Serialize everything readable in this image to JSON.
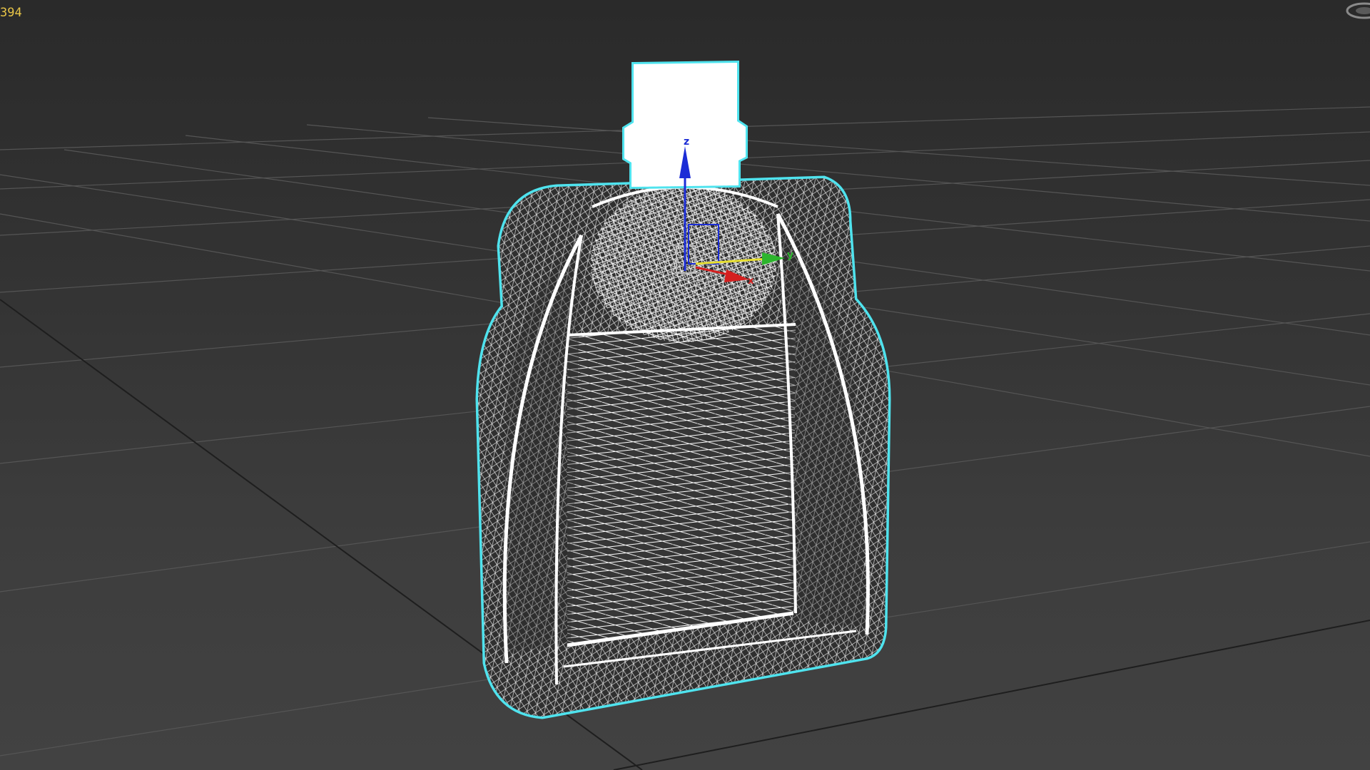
{
  "viewport": {
    "stats_value": "394",
    "shading_mode": "wireframe",
    "background_color": "#333333",
    "grid_color": "#555555",
    "selection_color": "#4fe3ee",
    "wire_color": "#ffffff"
  },
  "gizmo": {
    "axes": [
      {
        "name": "z",
        "label": "z",
        "color": "#1c2dd6"
      },
      {
        "name": "y",
        "label": "y",
        "color": "#2db52d"
      },
      {
        "name": "x",
        "label": "x",
        "color": "#d42020"
      }
    ]
  }
}
